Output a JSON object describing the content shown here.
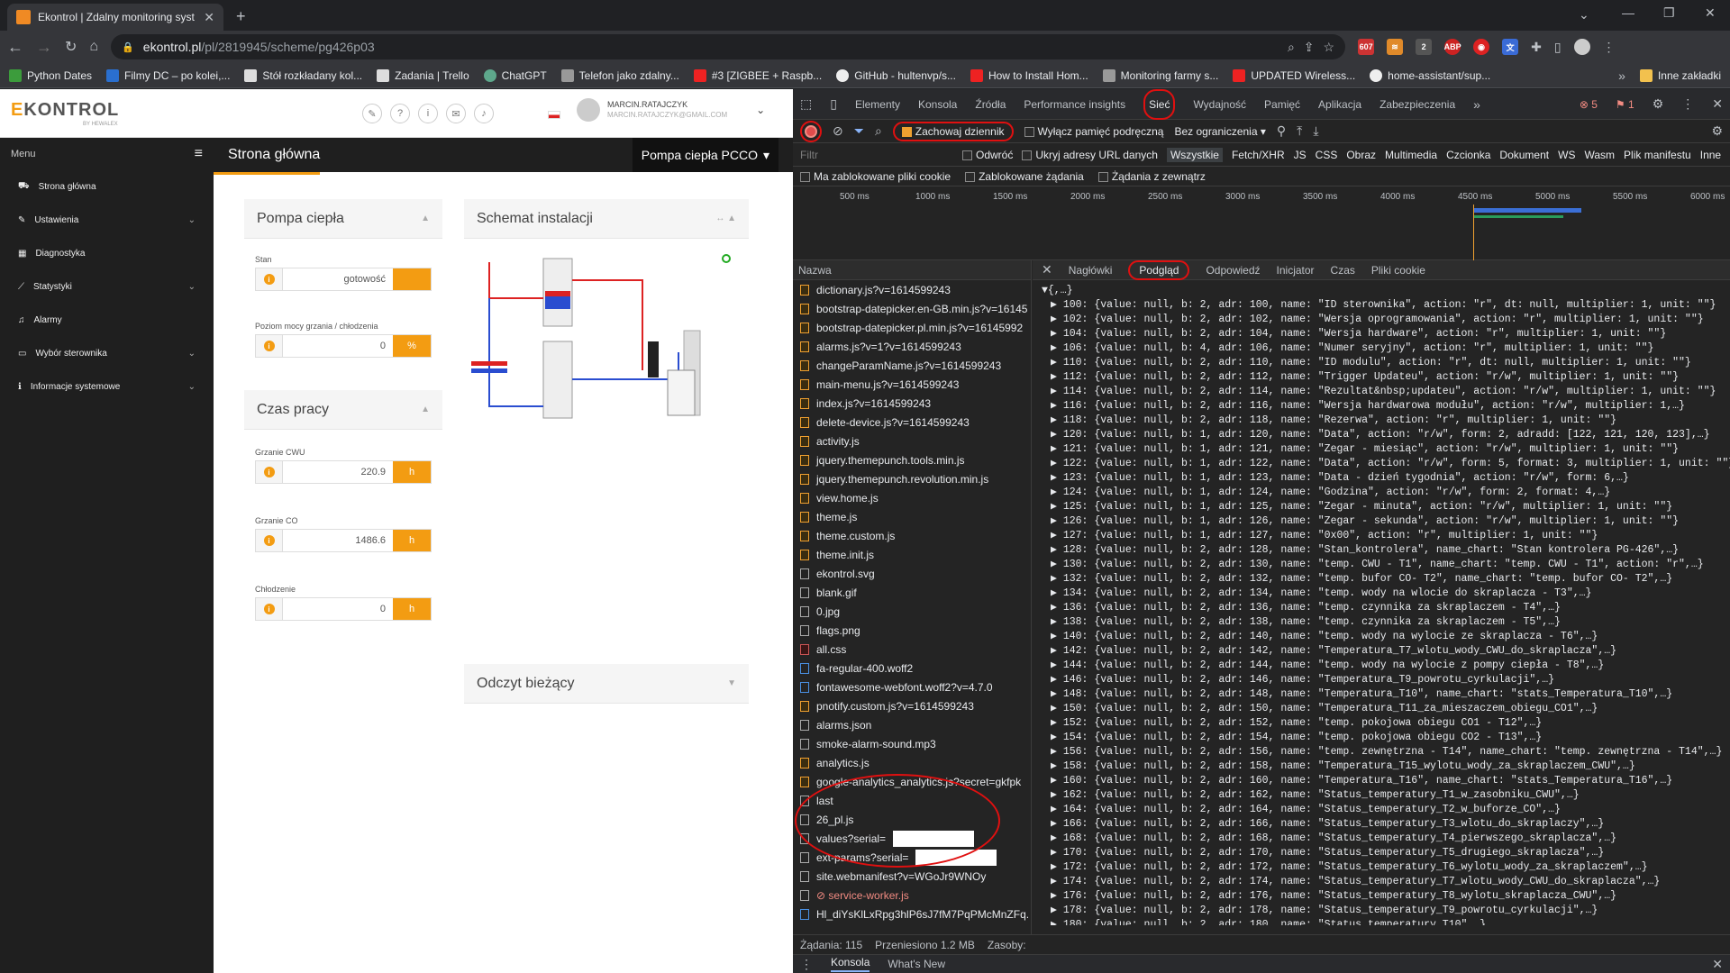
{
  "browser": {
    "tab_title": "Ekontrol | Zdalny monitoring syst",
    "url_host": "ekontrol.pl",
    "url_path": "/pl/2819945/scheme/pg426p03",
    "ext_badge_yt": "607",
    "ext_badge_2": "2"
  },
  "bookmarks": [
    {
      "label": "Python Dates",
      "color": "#3c9c3c"
    },
    {
      "label": "Filmy DC – po kolei,...",
      "color": "#2a6fcf"
    },
    {
      "label": "Stół rozkładany kol...",
      "color": "#dddddd"
    },
    {
      "label": "Zadania | Trello",
      "color": "#dddddd"
    },
    {
      "label": "ChatGPT",
      "color": "#5ea88c"
    },
    {
      "label": "Telefon jako zdalny...",
      "color": "#999999"
    },
    {
      "label": "#3 [ZIGBEE + Raspb...",
      "color": "#e22"
    },
    {
      "label": "GitHub - hultenvp/s...",
      "color": "#eeeeee"
    },
    {
      "label": "How to Install Hom...",
      "color": "#e22"
    },
    {
      "label": "Monitoring farmy s...",
      "color": "#999999"
    },
    {
      "label": "UPDATED Wireless...",
      "color": "#e22"
    },
    {
      "label": "home-assistant/sup...",
      "color": "#eeeeee"
    }
  ],
  "bookmarks_other": "Inne zakładki",
  "site": {
    "logo_main": "KONTROL",
    "logo_e": "E",
    "logo_by": "BY HEWALEX",
    "user_name": "MARCIN.RATAJCZYK",
    "user_email": "MARCIN.RATAJCZYK@GMAIL.COM",
    "menu_label": "Menu",
    "sidebar": [
      {
        "label": "Strona główna",
        "icon": "home-icon",
        "glyph": "⛟",
        "chev": ""
      },
      {
        "label": "Ustawienia",
        "icon": "wrench-icon",
        "glyph": "✎",
        "chev": "⌄"
      },
      {
        "label": "Diagnostyka",
        "icon": "calendar-icon",
        "glyph": "▦",
        "chev": ""
      },
      {
        "label": "Statystyki",
        "icon": "chart-line-icon",
        "glyph": "⟋",
        "chev": "⌄"
      },
      {
        "label": "Alarmy",
        "icon": "bell-icon",
        "glyph": "♫",
        "chev": ""
      },
      {
        "label": "Wybór sterownika",
        "icon": "controller-icon",
        "glyph": "▭",
        "chev": "⌄"
      },
      {
        "label": "Informacje systemowe",
        "icon": "info-icon",
        "glyph": "ℹ",
        "chev": "⌄"
      }
    ],
    "page_title": "Strona główna",
    "pump_select": "Pompa ciepła PCCO",
    "card_pompa": {
      "title": "Pompa ciepła",
      "fields": [
        {
          "label": "Stan",
          "value": "gotowość",
          "unit": ""
        },
        {
          "label": "Poziom mocy grzania / chłodzenia",
          "value": "0",
          "unit": "%"
        }
      ]
    },
    "card_czas": {
      "title": "Czas pracy",
      "fields": [
        {
          "label": "Grzanie CWU",
          "value": "220.9",
          "unit": "h"
        },
        {
          "label": "Grzanie CO",
          "value": "1486.6",
          "unit": "h"
        },
        {
          "label": "Chłodzenie",
          "value": "0",
          "unit": "h"
        }
      ]
    },
    "card_schemat": {
      "title": "Schemat instalacji"
    },
    "card_odczyt": {
      "title": "Odczyt bieżący"
    }
  },
  "devtools": {
    "tabs": [
      "Elementy",
      "Konsola",
      "Źródła",
      "Performance insights",
      "Sieć",
      "Wydajność",
      "Pamięć",
      "Aplikacja",
      "Zabezpieczenia"
    ],
    "active_tab": "Sieć",
    "errors": "5",
    "warnings": "1",
    "preserve_log": "Zachowaj dziennik",
    "disable_cache": "Wyłącz pamięć podręczną",
    "throttle": "Bez ograniczenia",
    "filter_placeholder": "Filtr",
    "invert": "Odwróć",
    "hide_data_urls": "Ukryj adresy URL danych",
    "types": [
      "Wszystkie",
      "Fetch/XHR",
      "JS",
      "CSS",
      "Obraz",
      "Multimedia",
      "Czcionka",
      "Dokument",
      "WS",
      "Wasm",
      "Plik manifestu",
      "Inne"
    ],
    "blocked_cookies": "Ma zablokowane pliki cookie",
    "blocked_requests": "Zablokowane żądania",
    "third_party": "Żądania z zewnątrz",
    "timeline_ticks": [
      "500 ms",
      "1000 ms",
      "1500 ms",
      "2000 ms",
      "2500 ms",
      "3000 ms",
      "3500 ms",
      "4000 ms",
      "4500 ms",
      "5000 ms",
      "5500 ms",
      "6000 ms"
    ],
    "name_header": "Nazwa",
    "requests": [
      {
        "name": "dictionary.js?v=1614599243",
        "type": "js"
      },
      {
        "name": "bootstrap-datepicker.en-GB.min.js?v=16145",
        "type": "js"
      },
      {
        "name": "bootstrap-datepicker.pl.min.js?v=16145992",
        "type": "js"
      },
      {
        "name": "alarms.js?v=1?v=1614599243",
        "type": "js"
      },
      {
        "name": "changeParamName.js?v=1614599243",
        "type": "js"
      },
      {
        "name": "main-menu.js?v=1614599243",
        "type": "js"
      },
      {
        "name": "index.js?v=1614599243",
        "type": "js"
      },
      {
        "name": "delete-device.js?v=1614599243",
        "type": "js"
      },
      {
        "name": "activity.js",
        "type": "js"
      },
      {
        "name": "jquery.themepunch.tools.min.js",
        "type": "js"
      },
      {
        "name": "jquery.themepunch.revolution.min.js",
        "type": "js"
      },
      {
        "name": "view.home.js",
        "type": "js"
      },
      {
        "name": "theme.js",
        "type": "js"
      },
      {
        "name": "theme.custom.js",
        "type": "js"
      },
      {
        "name": "theme.init.js",
        "type": "js"
      },
      {
        "name": "ekontrol.svg",
        "type": "img"
      },
      {
        "name": "blank.gif",
        "type": "img"
      },
      {
        "name": "0.jpg",
        "type": "img"
      },
      {
        "name": "flags.png",
        "type": "img"
      },
      {
        "name": "all.css",
        "type": "css"
      },
      {
        "name": "fa-regular-400.woff2",
        "type": "font"
      },
      {
        "name": "fontawesome-webfont.woff2?v=4.7.0",
        "type": "font"
      },
      {
        "name": "pnotify.custom.js?v=1614599243",
        "type": "js"
      },
      {
        "name": "alarms.json",
        "type": "doc"
      },
      {
        "name": "smoke-alarm-sound.mp3",
        "type": "doc"
      },
      {
        "name": "analytics.js",
        "type": "js"
      },
      {
        "name": "google-analytics_analytics.js?secret=gkfpk",
        "type": "js"
      },
      {
        "name": "last",
        "type": "doc"
      },
      {
        "name": "26_pl.js",
        "type": "doc"
      },
      {
        "name": "values?serial=",
        "type": "doc",
        "redacted": true
      },
      {
        "name": "ext-params?serial=",
        "type": "doc",
        "redacted": true
      },
      {
        "name": "site.webmanifest?v=WGoJr9WNOy",
        "type": "doc"
      },
      {
        "name": "⊘ service-worker.js",
        "type": "err"
      },
      {
        "name": "Hl_diYsKlLxRpg3hlP6sJ7fM7PqPMcMnZFq.",
        "type": "font"
      }
    ],
    "preview_tabs": [
      "Nagłówki",
      "Podgląd",
      "Odpowiedź",
      "Inicjator",
      "Czas",
      "Pliki cookie"
    ],
    "preview_active": "Podgląd",
    "preview_root": "▼{,…}",
    "preview_lines": [
      "▶ 100: {value: null, b: 2, adr: 100, name: \"ID sterownika\", action: \"r\", dt: null, multiplier: 1, unit: \"\"}",
      "▶ 102: {value: null, b: 2, adr: 102, name: \"Wersja oprogramowania\", action: \"r\", multiplier: 1, unit: \"\"}",
      "▶ 104: {value: null, b: 2, adr: 104, name: \"Wersja hardware\", action: \"r\", multiplier: 1, unit: \"\"}",
      "▶ 106: {value: null, b: 4, adr: 106, name: \"Numer seryjny\", action: \"r\", multiplier: 1, unit: \"\"}",
      "▶ 110: {value: null, b: 2, adr: 110, name: \"ID modulu\", action: \"r\", dt: null, multiplier: 1, unit: \"\"}",
      "▶ 112: {value: null, b: 2, adr: 112, name: \"Trigger Updateu\", action: \"r/w\", multiplier: 1, unit: \"\"}",
      "▶ 114: {value: null, b: 2, adr: 114, name: \"Rezultat&nbsp;updateu\", action: \"r/w\", multiplier: 1, unit: \"\"}",
      "▶ 116: {value: null, b: 2, adr: 116, name: \"Wersja hardwarowa modułu\", action: \"r/w\", multiplier: 1,…}",
      "▶ 118: {value: null, b: 2, adr: 118, name: \"Rezerwa\", action: \"r\", multiplier: 1, unit: \"\"}",
      "▶ 120: {value: null, b: 1, adr: 120, name: \"Data\", action: \"r/w\", form: 2, adradd: [122, 121, 120, 123],…}",
      "▶ 121: {value: null, b: 1, adr: 121, name: \"Zegar - miesiąc\", action: \"r/w\", multiplier: 1, unit: \"\"}",
      "▶ 122: {value: null, b: 1, adr: 122, name: \"Data\", action: \"r/w\", form: 5, format: 3, multiplier: 1, unit: \"\"}",
      "▶ 123: {value: null, b: 1, adr: 123, name: \"Data - dzień tygodnia\", action: \"r/w\", form: 6,…}",
      "▶ 124: {value: null, b: 1, adr: 124, name: \"Godzina\", action: \"r/w\", form: 2, format: 4,…}",
      "▶ 125: {value: null, b: 1, adr: 125, name: \"Zegar - minuta\", action: \"r/w\", multiplier: 1, unit: \"\"}",
      "▶ 126: {value: null, b: 1, adr: 126, name: \"Zegar - sekunda\", action: \"r/w\", multiplier: 1, unit: \"\"}",
      "▶ 127: {value: null, b: 1, adr: 127, name: \"0x00\", action: \"r\", multiplier: 1, unit: \"\"}",
      "▶ 128: {value: null, b: 2, adr: 128, name: \"Stan_kontrolera\", name_chart: \"Stan kontrolera PG-426\",…}",
      "▶ 130: {value: null, b: 2, adr: 130, name: \"temp. CWU - T1\", name_chart: \"temp. CWU - T1\", action: \"r\",…}",
      "▶ 132: {value: null, b: 2, adr: 132, name: \"temp. bufor CO- T2\", name_chart: \"temp. bufor CO- T2\",…}",
      "▶ 134: {value: null, b: 2, adr: 134, name: \"temp. wody na wlocie do skraplacza - T3\",…}",
      "▶ 136: {value: null, b: 2, adr: 136, name: \"temp. czynnika za skraplaczem - T4\",…}",
      "▶ 138: {value: null, b: 2, adr: 138, name: \"temp. czynnika za skraplaczem - T5\",…}",
      "▶ 140: {value: null, b: 2, adr: 140, name: \"temp. wody na wylocie ze skraplacza - T6\",…}",
      "▶ 142: {value: null, b: 2, adr: 142, name: \"Temperatura_T7_wlotu_wody_CWU_do_skraplacza\",…}",
      "▶ 144: {value: null, b: 2, adr: 144, name: \"temp. wody na wylocie z pompy ciepła - T8\",…}",
      "▶ 146: {value: null, b: 2, adr: 146, name: \"Temperatura_T9_powrotu_cyrkulacji\",…}",
      "▶ 148: {value: null, b: 2, adr: 148, name: \"Temperatura_T10\", name_chart: \"stats_Temperatura_T10\",…}",
      "▶ 150: {value: null, b: 2, adr: 150, name: \"Temperatura_T11_za_mieszaczem_obiegu_CO1\",…}",
      "▶ 152: {value: null, b: 2, adr: 152, name: \"temp. pokojowa obiegu CO1 - T12\",…}",
      "▶ 154: {value: null, b: 2, adr: 154, name: \"temp. pokojowa obiegu CO2 - T13\",…}",
      "▶ 156: {value: null, b: 2, adr: 156, name: \"temp. zewnętrzna - T14\", name_chart: \"temp. zewnętrzna - T14\",…}",
      "▶ 158: {value: null, b: 2, adr: 158, name: \"Temperatura_T15_wylotu_wody_za_skraplaczem_CWU\",…}",
      "▶ 160: {value: null, b: 2, adr: 160, name: \"Temperatura_T16\", name_chart: \"stats_Temperatura_T16\",…}",
      "▶ 162: {value: null, b: 2, adr: 162, name: \"Status_temperatury_T1_w_zasobniku_CWU\",…}",
      "▶ 164: {value: null, b: 2, adr: 164, name: \"Status_temperatury_T2_w_buforze_CO\",…}",
      "▶ 166: {value: null, b: 2, adr: 166, name: \"Status_temperatury_T3_wlotu_do_skraplaczy\",…}",
      "▶ 168: {value: null, b: 2, adr: 168, name: \"Status_temperatury_T4_pierwszego_skraplacza\",…}",
      "▶ 170: {value: null, b: 2, adr: 170, name: \"Status_temperatury_T5_drugiego_skraplacza\",…}",
      "▶ 172: {value: null, b: 2, adr: 172, name: \"Status_temperatury_T6_wylotu_wody_za_skraplaczem\",…}",
      "▶ 174: {value: null, b: 2, adr: 174, name: \"Status_temperatury_T7_wlotu_wody_CWU_do_skraplacza\",…}",
      "▶ 176: {value: null, b: 2, adr: 176, name: \"Status_temperatury_T8_wylotu_skraplacza_CWU\",…}",
      "▶ 178: {value: null, b: 2, adr: 178, name: \"Status_temperatury_T9_powrotu_cyrkulacji\",…}",
      "▶ 180: {value: null, b: 2, adr: 180, name: \"Status_temperatury_T10\",…}"
    ],
    "status_requests": "Żądania: 115",
    "status_transferred": "Przeniesiono 1.2 MB",
    "status_resources": "Zasoby:",
    "drawer_tabs": [
      "Konsola",
      "What's New"
    ]
  }
}
